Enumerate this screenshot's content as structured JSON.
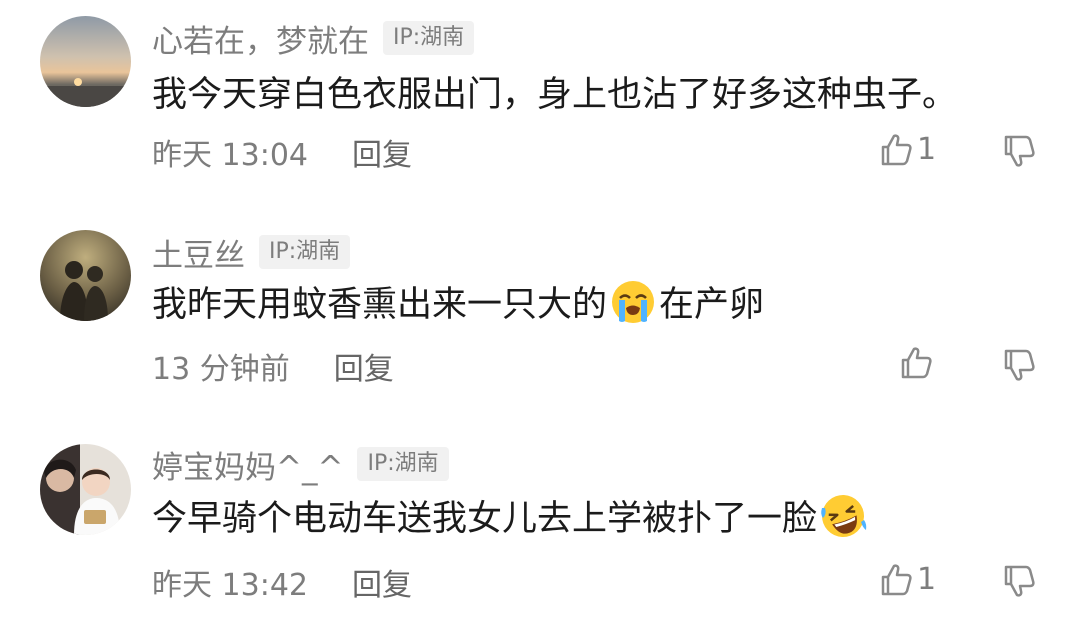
{
  "comments": [
    {
      "username": "心若在，梦就在",
      "ip": "IP:湖南",
      "text": "我今天穿白色衣服出门，身上也沾了好多这种虫子。",
      "text_after_emoji": "",
      "emoji": "",
      "time": "昨天 13:04",
      "reply_label": "回复",
      "likes": "1",
      "avatar": "sunset-landscape"
    },
    {
      "username": "土豆丝",
      "ip": "IP:湖南",
      "text": "我昨天用蚊香熏出来一只大的",
      "emoji": "loudly-crying-face",
      "text_after_emoji": "在产卵",
      "time": "13 分钟前",
      "reply_label": "回复",
      "likes": "",
      "avatar": "couple-silhouette"
    },
    {
      "username": "婷宝妈妈^_^",
      "ip": "IP:湖南",
      "text": "今早骑个电动车送我女儿去上学被扑了一脸",
      "emoji": "rolling-laughing-face",
      "text_after_emoji": "",
      "time": "昨天 13:42",
      "reply_label": "回复",
      "likes": "1",
      "avatar": "mother-and-baby"
    }
  ],
  "colors": {
    "secondary_text": "#7d7d7d",
    "primary_text": "#1b1b1b",
    "badge_bg": "#f1f1f1"
  }
}
